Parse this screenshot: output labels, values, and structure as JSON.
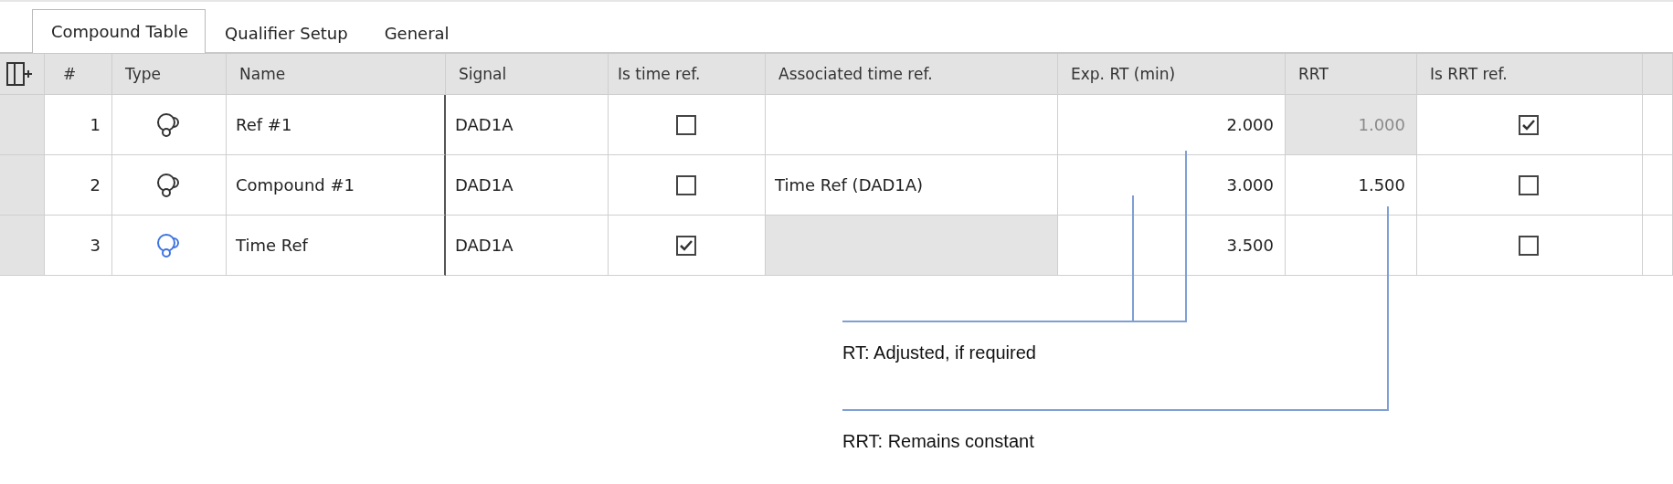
{
  "tabs": [
    {
      "label": "Compound Table",
      "selected": true
    },
    {
      "label": "Qualifier Setup",
      "selected": false
    },
    {
      "label": "General",
      "selected": false
    }
  ],
  "table": {
    "columns": [
      "#",
      "Type",
      "Name",
      "Signal",
      "Is time ref.",
      "Associated time ref.",
      "Exp. RT (min)",
      "RRT",
      "Is RRT ref."
    ],
    "rows": [
      {
        "number": "1",
        "type": {
          "color": "#333333"
        },
        "name": "Ref #1",
        "signal": "DAD1A",
        "is_time_ref": {
          "checked": false
        },
        "associated_time_ref": {
          "disabled": false
        },
        "exp_rt": "2.000",
        "rrt": {
          "text": "1.000",
          "disabled": true
        },
        "is_rrt_ref": {
          "checked": true
        }
      },
      {
        "number": "2",
        "type": {
          "color": "#333333"
        },
        "name": "Compound #1",
        "signal": "DAD1A",
        "is_time_ref": {
          "checked": false
        },
        "associated_time_ref": {
          "text": "Time Ref (DAD1A)",
          "disabled": false
        },
        "exp_rt": "3.000",
        "rrt": {
          "text": "1.500",
          "disabled": false
        },
        "is_rrt_ref": {
          "checked": false
        }
      },
      {
        "number": "3",
        "type": {
          "color": "#3f74e0"
        },
        "name": "Time Ref",
        "signal": "DAD1A",
        "is_time_ref": {
          "checked": true
        },
        "associated_time_ref": {
          "disabled": true
        },
        "exp_rt": "3.500",
        "rrt": {
          "disabled": false
        },
        "is_rrt_ref": {
          "checked": false
        }
      }
    ]
  },
  "annotations": [
    {
      "text": "RT: Adjusted, if required"
    },
    {
      "text": "RRT: Remains constant"
    }
  ]
}
